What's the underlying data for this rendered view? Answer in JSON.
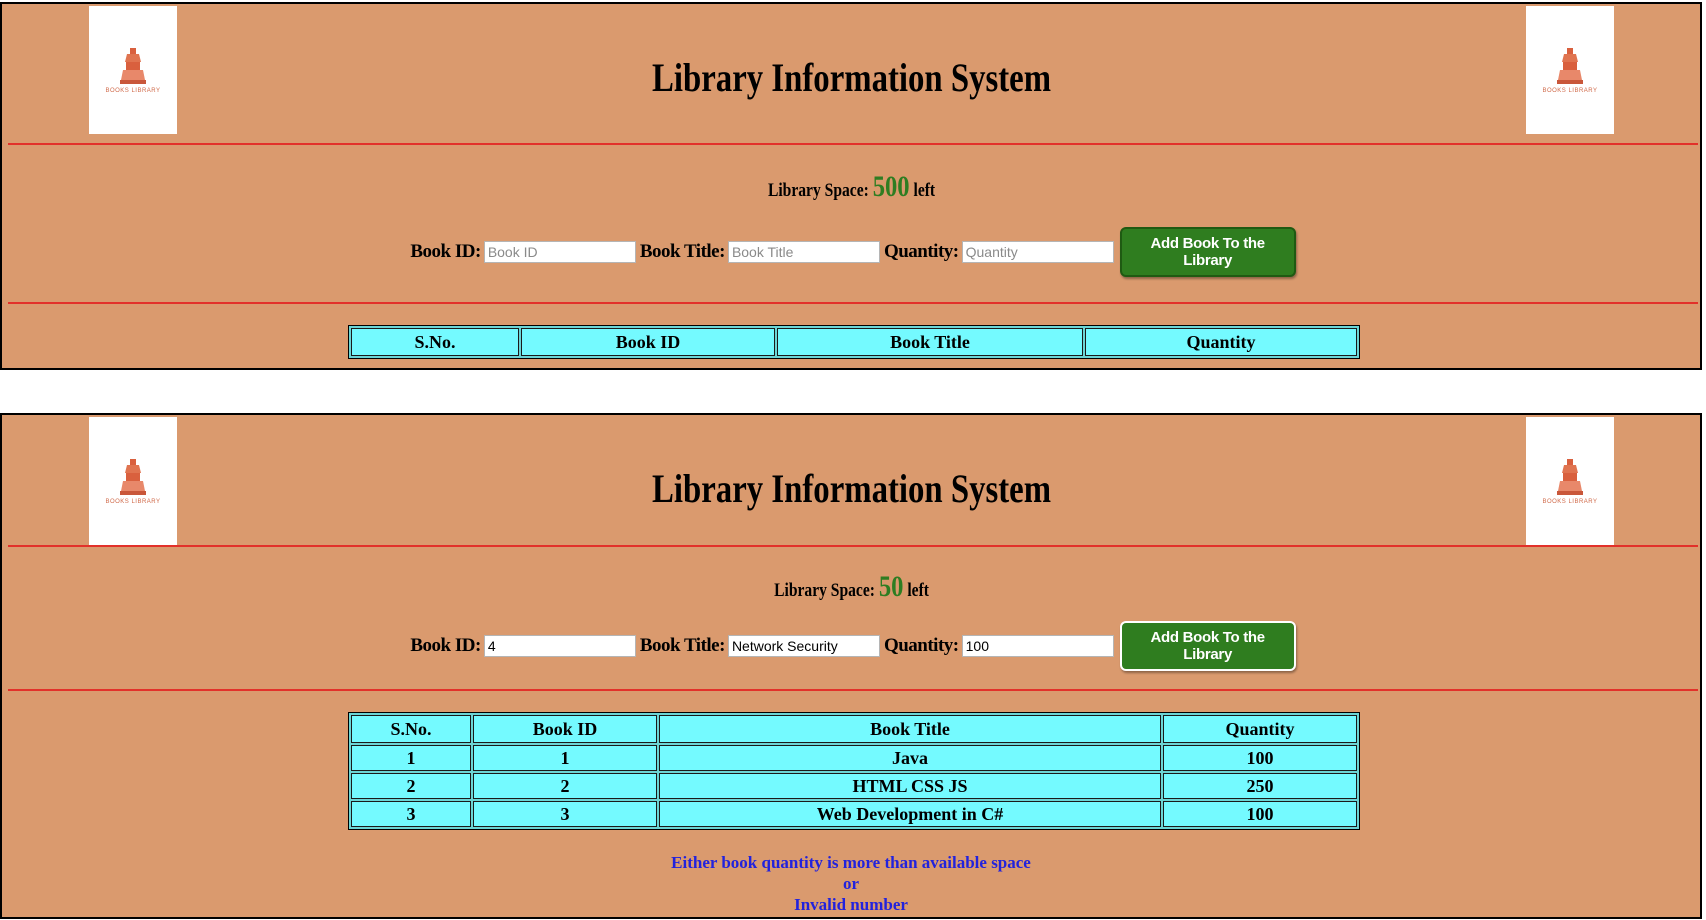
{
  "colors": {
    "panel_bg": "#da9a6e",
    "divider": "#e2312a",
    "space_value": "#2e7d22",
    "button_bg": "#2f7d1f",
    "table_cell": "#74faff",
    "message": "#2222dd"
  },
  "logo_text": "BOOKS LIBRARY",
  "panels": [
    {
      "title": "Library Information System",
      "space_label": "Library Space:",
      "space_value": "500",
      "space_suffix": "left",
      "form": {
        "book_id_label": "Book ID:",
        "book_id_placeholder": "Book ID",
        "book_id_value": "",
        "book_title_label": "Book Title:",
        "book_title_placeholder": "Book Title",
        "book_title_value": "",
        "quantity_label": "Quantity:",
        "quantity_placeholder": "Quantity",
        "quantity_value": "",
        "add_button": "Add Book To the Library"
      },
      "table": {
        "headers": [
          "S.No.",
          "Book ID",
          "Book Title",
          "Quantity"
        ],
        "rows": []
      }
    },
    {
      "title": "Library Information System",
      "space_label": "Library Space:",
      "space_value": "50",
      "space_suffix": "left",
      "form": {
        "book_id_label": "Book ID:",
        "book_id_placeholder": "Book ID",
        "book_id_value": "4",
        "book_title_label": "Book Title:",
        "book_title_placeholder": "Book Title",
        "book_title_value": "Network Security",
        "quantity_label": "Quantity:",
        "quantity_placeholder": "Quantity",
        "quantity_value": "100",
        "add_button": "Add Book To the Library"
      },
      "table": {
        "headers": [
          "S.No.",
          "Book ID",
          "Book Title",
          "Quantity"
        ],
        "rows": [
          [
            "1",
            "1",
            "Java",
            "100"
          ],
          [
            "2",
            "2",
            "HTML CSS JS",
            "250"
          ],
          [
            "3",
            "3",
            "Web Development in C#",
            "100"
          ]
        ]
      },
      "message": {
        "line1": "Either book quantity is more than available space",
        "line2": "or",
        "line3": "Invalid number"
      }
    }
  ]
}
